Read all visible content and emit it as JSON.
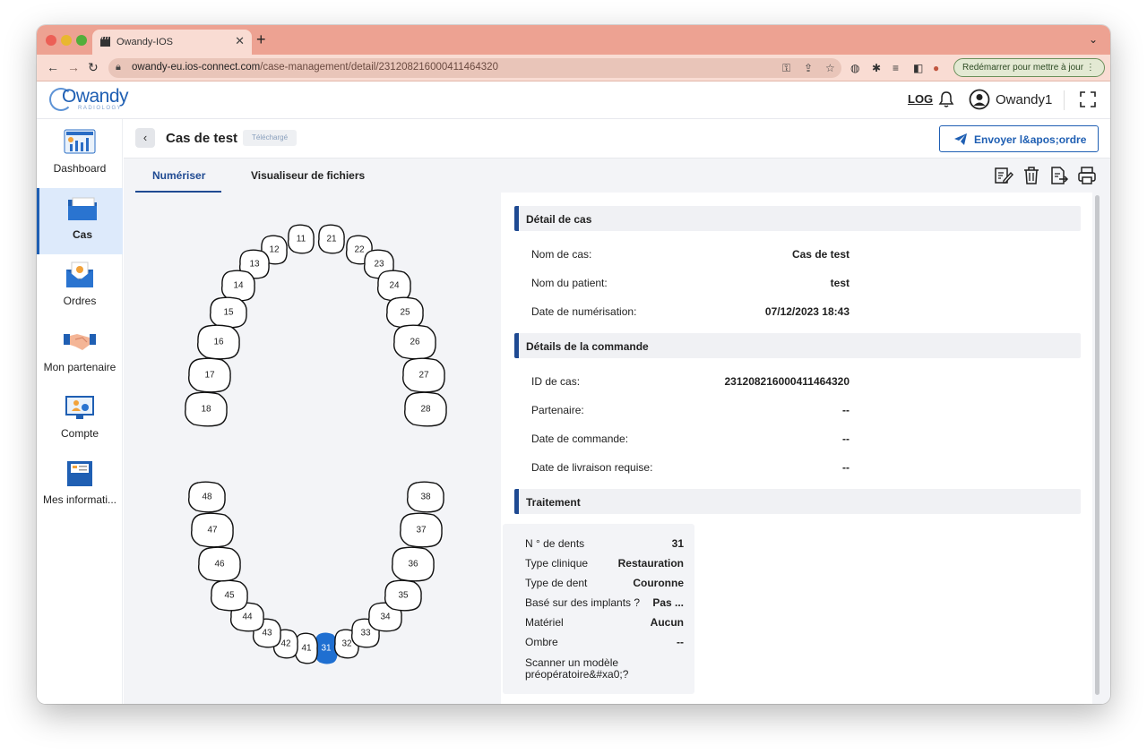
{
  "browser": {
    "tab_title": "Owandy-IOS",
    "url_host": "owandy-eu.ios-connect.com",
    "url_path": "/case-management/detail/23120821600041146​4320",
    "relaunch_label": "Redémarrer pour mettre à jour"
  },
  "header": {
    "logo_text": "Owandy",
    "logo_sub": "RADIOLOGY",
    "log_label": "LOG",
    "user_name": "Owandy1"
  },
  "sidebar": {
    "items": [
      {
        "label": "Dashboard"
      },
      {
        "label": "Cas"
      },
      {
        "label": "Ordres"
      },
      {
        "label": "Mon partenaire"
      },
      {
        "label": "Compte"
      },
      {
        "label": "Mes informati..."
      }
    ]
  },
  "case": {
    "title": "Cas de test",
    "status": "Téléchargé",
    "send_label": "Envoyer l&apos;ordre"
  },
  "tabs": [
    "Numériser",
    "Visualiseur de fichiers"
  ],
  "teeth": {
    "upper": [
      "11",
      "12",
      "13",
      "14",
      "15",
      "16",
      "17",
      "18",
      "21",
      "22",
      "23",
      "24",
      "25",
      "26",
      "27",
      "28"
    ],
    "lower": [
      "31",
      "32",
      "33",
      "34",
      "35",
      "36",
      "37",
      "38",
      "41",
      "42",
      "43",
      "44",
      "45",
      "46",
      "47",
      "48"
    ],
    "selected": "31"
  },
  "details": {
    "section_case": "Détail de cas",
    "case_rows": [
      {
        "k": "Nom de cas:",
        "v": "Cas de test"
      },
      {
        "k": "Nom du patient:",
        "v": "test"
      },
      {
        "k": "Date de numérisation:",
        "v": "07/12/2023 18:43"
      }
    ],
    "section_order": "Détails de la commande",
    "order_rows": [
      {
        "k": "ID de cas:",
        "v": "231208216000411464320"
      },
      {
        "k": "Partenaire:",
        "v": "--"
      },
      {
        "k": "Date de commande:",
        "v": "--"
      },
      {
        "k": "Date de livraison requise:",
        "v": "--"
      }
    ],
    "section_treatment": "Traitement",
    "treatment_rows": [
      {
        "k": "N ° de dents",
        "v": "31"
      },
      {
        "k": "Type clinique",
        "v": "Restauration"
      },
      {
        "k": "Type de dent",
        "v": "Couronne"
      },
      {
        "k": "Basé sur des implants ?",
        "v": "Pas ..."
      },
      {
        "k": "Matériel",
        "v": "Aucun"
      },
      {
        "k": "Ombre",
        "v": "--"
      }
    ],
    "scanner_label_1": "Scanner un modèle",
    "scanner_label_2": "préopératoire&#xa0;?"
  }
}
